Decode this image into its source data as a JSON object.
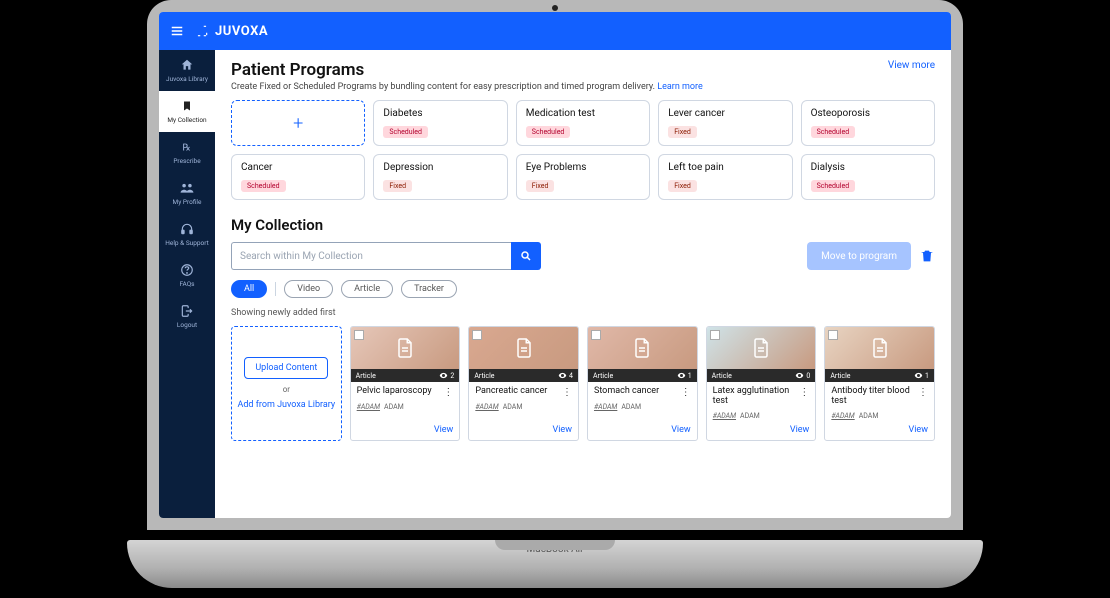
{
  "brand": "JUVOXA",
  "laptop_label": "MacBook Air",
  "sidebar": {
    "items": [
      {
        "label": "Juvoxa Library",
        "icon": "home-icon",
        "active": false
      },
      {
        "label": "My Collection",
        "icon": "bookmark-icon",
        "active": true
      },
      {
        "label": "Prescribe",
        "icon": "rx-icon",
        "active": false
      },
      {
        "label": "My Profile",
        "icon": "profile-icon",
        "active": false
      },
      {
        "label": "Help & Support",
        "icon": "headphones-icon",
        "active": false
      },
      {
        "label": "FAQs",
        "icon": "faq-icon",
        "active": false
      },
      {
        "label": "Logout",
        "icon": "logout-icon",
        "active": false
      }
    ]
  },
  "programs": {
    "heading": "Patient Programs",
    "subtitle_prefix": "Create Fixed or Scheduled Programs by bundling content for easy prescription and timed program delivery. ",
    "learn_more": "Learn more",
    "view_more": "View more",
    "add_symbol": "+",
    "cards": [
      {
        "title": "Diabetes",
        "status": "Scheduled",
        "status_type": "sched"
      },
      {
        "title": "Medication test",
        "status": "Scheduled",
        "status_type": "sched"
      },
      {
        "title": "Lever cancer",
        "status": "Fixed",
        "status_type": "fixed"
      },
      {
        "title": "Osteoporosis",
        "status": "Scheduled",
        "status_type": "sched"
      },
      {
        "title": "Cancer",
        "status": "Scheduled",
        "status_type": "sched"
      },
      {
        "title": "Depression",
        "status": "Fixed",
        "status_type": "fixed"
      },
      {
        "title": "Eye Problems",
        "status": "Fixed",
        "status_type": "fixed"
      },
      {
        "title": "Left toe pain",
        "status": "Fixed",
        "status_type": "fixed"
      },
      {
        "title": "Dialysis",
        "status": "Scheduled",
        "status_type": "sched"
      }
    ]
  },
  "collection": {
    "heading": "My Collection",
    "search_placeholder": "Search within My Collection",
    "move_label": "Move to program",
    "chips": [
      "All",
      "Video",
      "Article",
      "Tracker"
    ],
    "sort_label": "Showing newly added first",
    "upload": {
      "button": "Upload Content",
      "or": "or",
      "alt": "Add from Juvoxa Library"
    },
    "items": [
      {
        "type": "Article",
        "views": "2",
        "title": "Pelvic laparoscopy",
        "source1": "#ADAM",
        "source2": "ADAM",
        "view_label": "View"
      },
      {
        "type": "Article",
        "views": "4",
        "title": "Pancreatic cancer",
        "source1": "#ADAM",
        "source2": "ADAM",
        "view_label": "View"
      },
      {
        "type": "Article",
        "views": "1",
        "title": "Stomach cancer",
        "source1": "#ADAM",
        "source2": "ADAM",
        "view_label": "View"
      },
      {
        "type": "Article",
        "views": "0",
        "title": "Latex agglutination test",
        "source1": "#ADAM",
        "source2": "ADAM",
        "view_label": "View"
      },
      {
        "type": "Article",
        "views": "1",
        "title": "Antibody titer blood test",
        "source1": "#ADAM",
        "source2": "ADAM",
        "view_label": "View"
      }
    ]
  }
}
